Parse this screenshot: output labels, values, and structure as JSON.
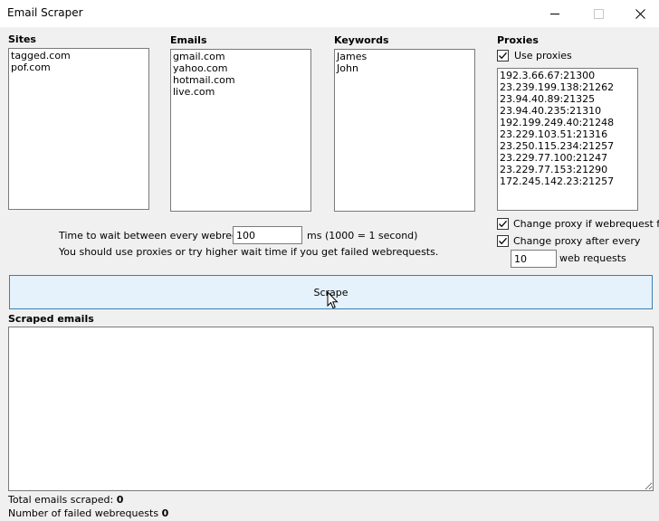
{
  "window": {
    "title": "Email Scraper"
  },
  "sites": {
    "label": "Sites",
    "items": [
      "tagged.com",
      "pof.com"
    ]
  },
  "emails": {
    "label": "Emails",
    "items": [
      "gmail.com",
      "yahoo.com",
      "hotmail.com",
      "live.com"
    ]
  },
  "keywords": {
    "label": "Keywords",
    "items": [
      "James",
      "John"
    ]
  },
  "proxies": {
    "label": "Proxies",
    "use_label": "Use proxies",
    "use_checked": true,
    "items": [
      "192.3.66.67:21300",
      "23.239.199.138:21262",
      "23.94.40.89:21325",
      "23.94.40.235:21310",
      "192.199.249.40:21248",
      "23.229.103.51:21316",
      "23.250.115.234:21257",
      "23.229.77.100:21247",
      "23.229.77.153:21290",
      "172.245.142.23:21257"
    ],
    "change_fail_label": "Change proxy if webrequest fail",
    "change_fail_checked": true,
    "change_every_label": "Change proxy after every",
    "change_every_checked": true,
    "every_value": "10",
    "every_unit": "web requests"
  },
  "wait": {
    "label": "Time to wait between every webrequest",
    "value": "100",
    "unit": "ms (1000 = 1 second)",
    "hint": "You should use proxies or try higher wait time if you get failed webrequests."
  },
  "scrape_button": "Scrape",
  "output": {
    "label": "Scraped emails"
  },
  "stats": {
    "total_label": "Total emails scraped:",
    "total_value": "0",
    "failed_label": "Number of failed webrequests",
    "failed_value": "0"
  }
}
